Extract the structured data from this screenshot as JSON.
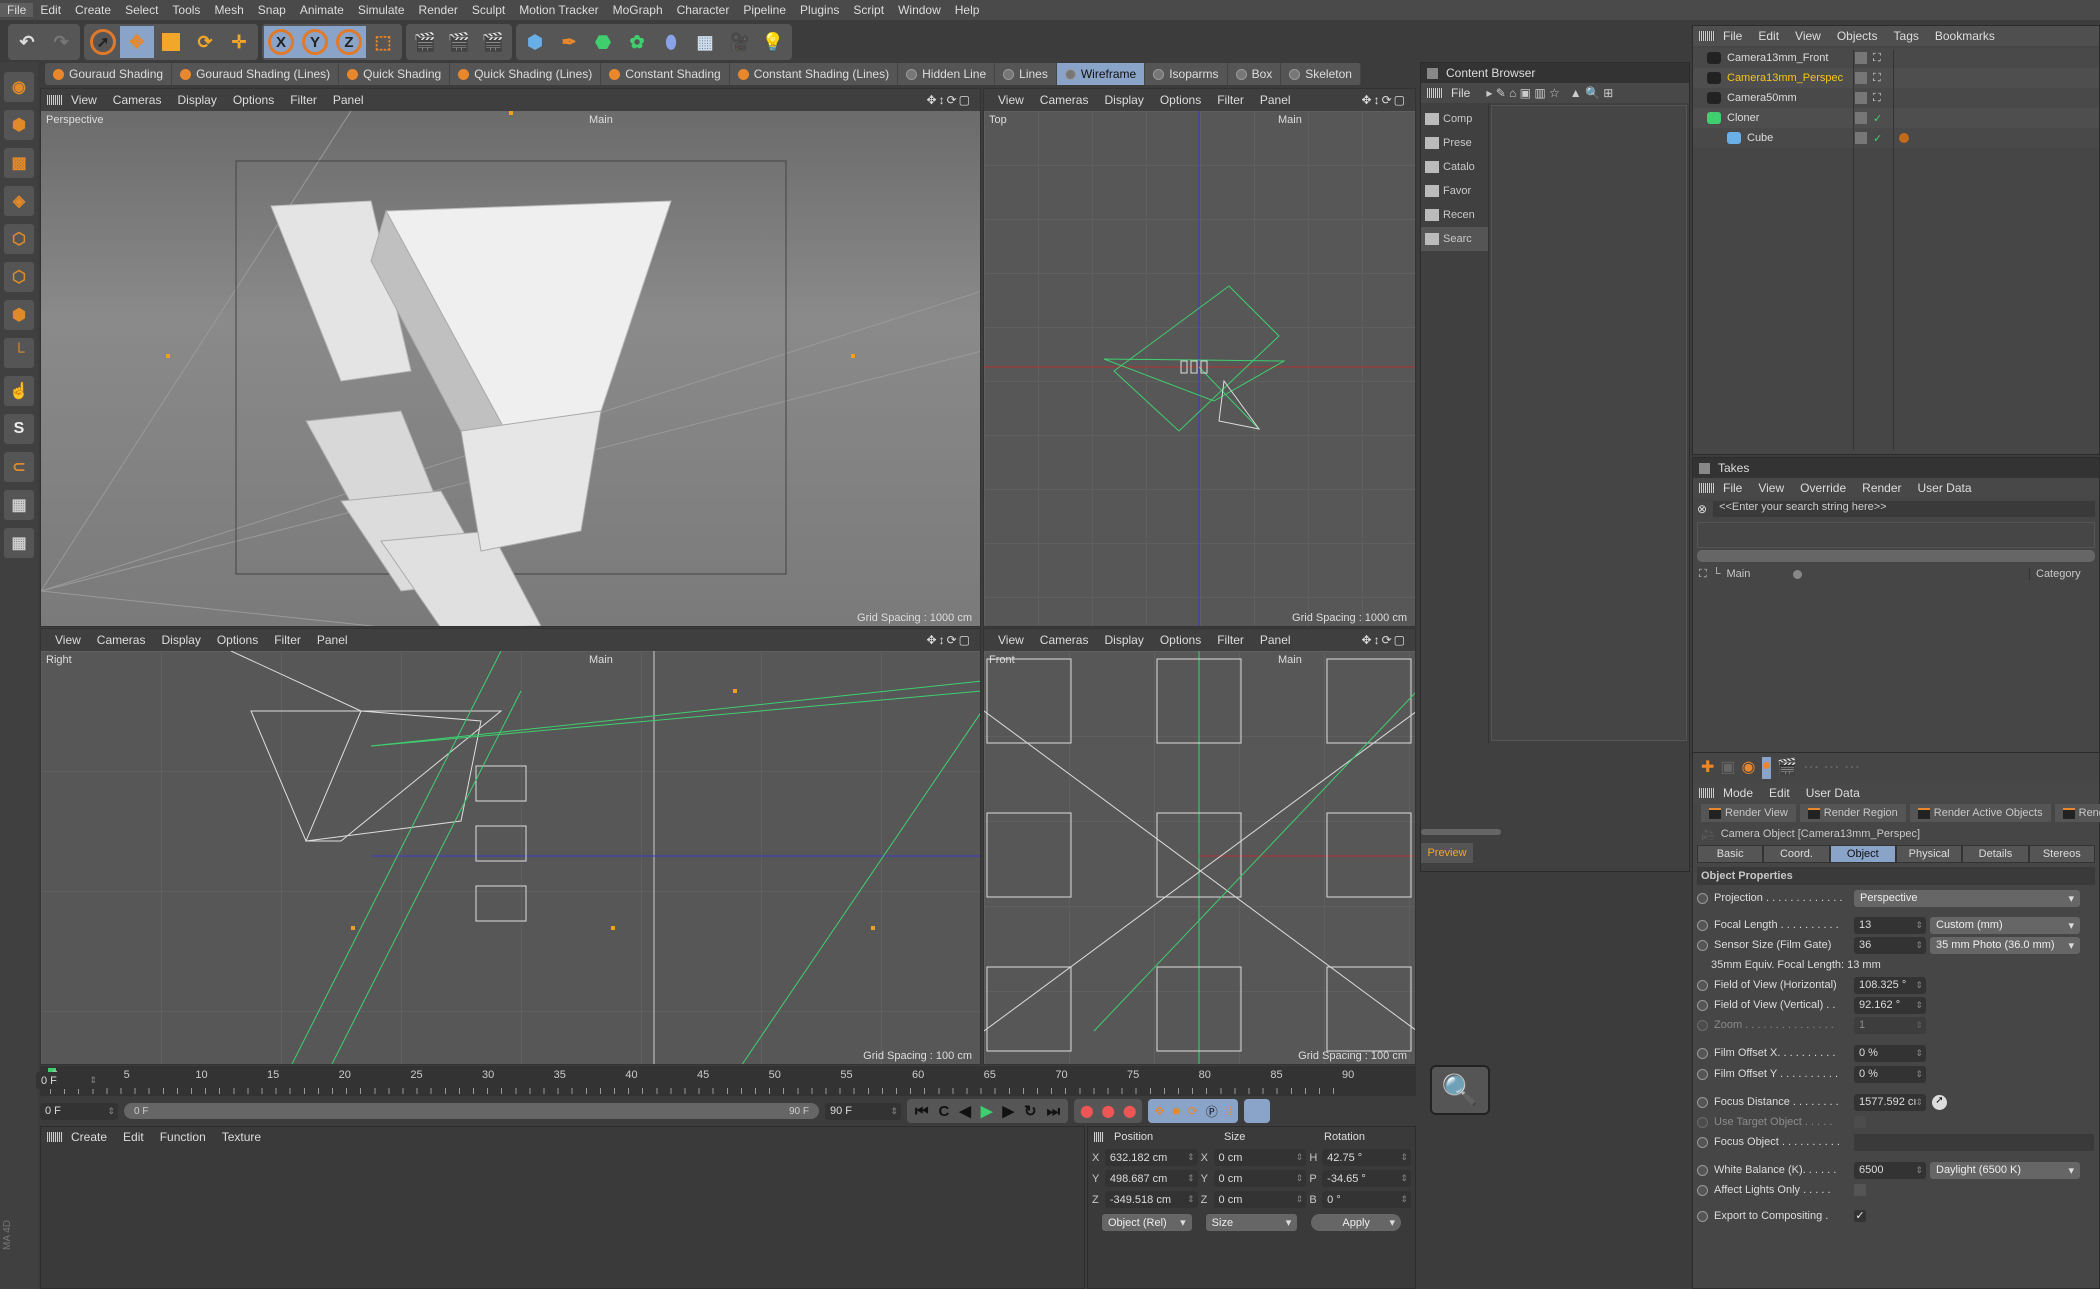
{
  "menu": [
    "File",
    "Edit",
    "Create",
    "Select",
    "Tools",
    "Mesh",
    "Snap",
    "Animate",
    "Simulate",
    "Render",
    "Sculpt",
    "Motion Tracker",
    "MoGraph",
    "Character",
    "Pipeline",
    "Plugins",
    "Script",
    "Window",
    "Help"
  ],
  "toolbar": {
    "axis_x": "X",
    "axis_y": "Y",
    "axis_z": "Z"
  },
  "shading": [
    "Gouraud Shading",
    "Gouraud Shading (Lines)",
    "Quick Shading",
    "Quick Shading (Lines)",
    "Constant Shading",
    "Constant Shading (Lines)",
    "Hidden Line",
    "Lines",
    "Wireframe",
    "Isoparms",
    "Box",
    "Skeleton"
  ],
  "viewport_menu": [
    "View",
    "Cameras",
    "Display",
    "Options",
    "Filter",
    "Panel"
  ],
  "viewports": {
    "perspective": {
      "label": "Perspective",
      "camera": "Main",
      "grid": "Grid Spacing : 1000 cm"
    },
    "top": {
      "label": "Top",
      "camera": "Main",
      "grid": "Grid Spacing : 1000 cm"
    },
    "right": {
      "label": "Right",
      "camera": "Main",
      "grid": "Grid Spacing : 100 cm"
    },
    "front": {
      "label": "Front",
      "camera": "Main",
      "grid": "Grid Spacing : 100 cm"
    }
  },
  "timeline": {
    "ticks": [
      "0",
      "5",
      "10",
      "15",
      "20",
      "25",
      "30",
      "35",
      "40",
      "45",
      "50",
      "55",
      "60",
      "65",
      "70",
      "75",
      "80",
      "85",
      "90"
    ],
    "current": "0 F",
    "start": "0 F",
    "range_start": "0 F",
    "range_end": "90 F",
    "end": "90 F",
    "progress": 0
  },
  "material": {
    "menu": [
      "Create",
      "Edit",
      "Function",
      "Texture"
    ]
  },
  "coords": {
    "headers": [
      "Position",
      "Size",
      "Rotation"
    ],
    "rows": [
      {
        "a": "X",
        "pos": "632.182 cm",
        "b": "X",
        "size": "0 cm",
        "c": "H",
        "rot": "42.75 °"
      },
      {
        "a": "Y",
        "pos": "498.687 cm",
        "b": "Y",
        "size": "0 cm",
        "c": "P",
        "rot": "-34.65 °"
      },
      {
        "a": "Z",
        "pos": "-349.518 cm",
        "b": "Z",
        "size": "0 cm",
        "c": "B",
        "rot": "0 °"
      }
    ],
    "mode": "Object (Rel)",
    "size_mode": "Size",
    "apply": "Apply"
  },
  "content_browser": {
    "title": "Content Browser",
    "menu": "File",
    "items": [
      "Comp",
      "Prese",
      "Catalo",
      "Favor",
      "Recen",
      "Searc"
    ],
    "preview": "Preview"
  },
  "object_manager": {
    "menu": [
      "File",
      "Edit",
      "View",
      "Objects",
      "Tags",
      "Bookmarks"
    ],
    "objects": [
      {
        "name": "Camera13mm_Front",
        "icon": "camera-icon",
        "active": false
      },
      {
        "name": "Camera13mm_Perspec",
        "icon": "camera-icon",
        "active": true
      },
      {
        "name": "Camera50mm",
        "icon": "camera-icon",
        "active": false
      },
      {
        "name": "Cloner",
        "icon": "cloner-icon",
        "active": false
      },
      {
        "name": "Cube",
        "icon": "cube-icon",
        "active": false
      }
    ]
  },
  "takes": {
    "title": "Takes",
    "menu": [
      "File",
      "View",
      "Override",
      "Render",
      "User Data"
    ],
    "search_placeholder": "<<Enter your search string here>>",
    "main": "Main",
    "category": "Category"
  },
  "attributes": {
    "menu": [
      "Mode",
      "Edit",
      "User Data"
    ],
    "render_buttons": [
      "Render View",
      "Render Region",
      "Render Active Objects",
      "Rend"
    ],
    "title": "Camera Object [Camera13mm_Perspec]",
    "tabs": [
      "Basic",
      "Coord.",
      "Object",
      "Physical",
      "Details",
      "Stereos"
    ],
    "active_tab": "Object",
    "section": "Object Properties",
    "projection": {
      "label": "Projection . . . . . . . . . . . . .",
      "value": "Perspective"
    },
    "focal_length": {
      "label": "Focal Length . . . . . . . . . .",
      "value": "13",
      "preset": "Custom (mm)"
    },
    "sensor": {
      "label": "Sensor Size (Film Gate)",
      "value": "36",
      "preset": "35 mm Photo (36.0 mm)"
    },
    "equiv": "35mm Equiv. Focal Length: 13 mm",
    "fov_h": {
      "label": "Field of View (Horizontal)",
      "value": "108.325 °"
    },
    "fov_v": {
      "label": "Field of View (Vertical) . .",
      "value": "92.162 °"
    },
    "zoom": {
      "label": "Zoom . . . . . . . . . . . . . . .",
      "value": "1"
    },
    "offset_x": {
      "label": "Film Offset X. . . . . . . . . .",
      "value": "0 %"
    },
    "offset_y": {
      "label": "Film Offset Y . . . . . . . . . .",
      "value": "0 %"
    },
    "focus_distance": {
      "label": "Focus Distance . . . . . . . .",
      "value": "1577.592 cı"
    },
    "use_target": {
      "label": "Use Target Object . . . . .",
      "checked": false
    },
    "focus_object": {
      "label": "Focus Object . . . . . . . . . .",
      "value": ""
    },
    "white_balance": {
      "label": "White Balance (K). . . . . .",
      "value": "6500",
      "preset": "Daylight (6500 K)"
    },
    "affect_lights": {
      "label": "Affect Lights Only . . . . .",
      "checked": false
    },
    "export": {
      "label": "Export to Compositing .",
      "checked": true,
      "mark": "✓"
    }
  },
  "colors": {
    "accent": "#8aa3c8",
    "orange": "#e8872b",
    "active_object": "#f5c518",
    "wire_green": "#3fcf6f"
  }
}
